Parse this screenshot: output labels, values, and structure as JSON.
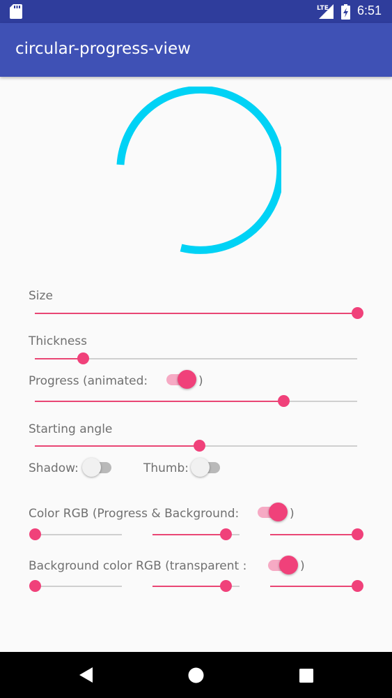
{
  "status_bar": {
    "network": "LTE",
    "time": "6:51",
    "icons": [
      "sd-card-icon",
      "signal-icon",
      "battery-charging-icon"
    ]
  },
  "app_bar": {
    "title": "circular-progress-view"
  },
  "progress_view": {
    "color": "#00d2f5",
    "progress": 0.8,
    "icon": "circular-progress-ring"
  },
  "controls": {
    "size": {
      "label": "Size",
      "value": 1.0
    },
    "thickness": {
      "label": "Thickness",
      "value": 0.15
    },
    "progress": {
      "label": "Progress (animated:",
      "close": ")",
      "animated": true,
      "value": 0.77
    },
    "starting_angle": {
      "label": "Starting angle",
      "value": 0.51
    },
    "shadow": {
      "label": "Shadow:",
      "on": false
    },
    "thumb": {
      "label": "Thumb:",
      "on": false
    },
    "color_rgb": {
      "label": "Color RGB (Progress & Background:",
      "close": ")",
      "on": true,
      "r": 0.0,
      "g": 0.84,
      "b": 1.0
    },
    "background_rgb": {
      "label": "Background color RGB   (transparent :",
      "close": ")",
      "on": true,
      "r": 0.0,
      "g": 0.84,
      "b": 1.0
    }
  },
  "colors": {
    "status_bar": "#2f3d9c",
    "app_bar": "#3f51b5",
    "accent": "#f0417a",
    "ring": "#00d2f5"
  },
  "nav_bar": {
    "icons": [
      "back-triangle-icon",
      "home-circle-icon",
      "recents-square-icon"
    ]
  }
}
